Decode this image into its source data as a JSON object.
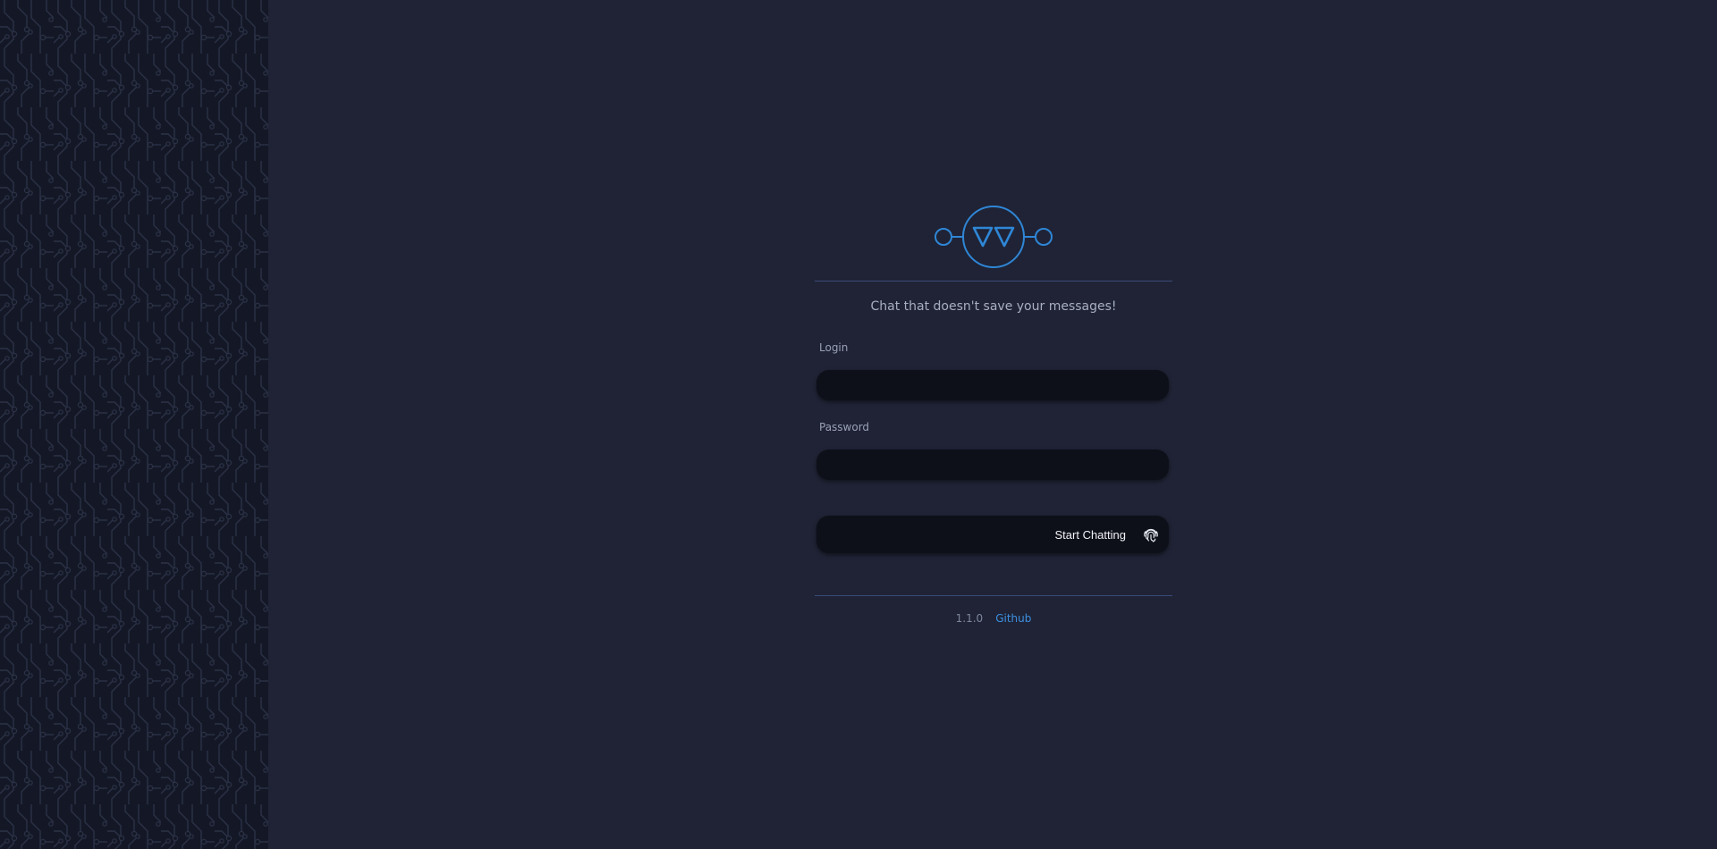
{
  "sidebar": {
    "decoration": "circuit-board-pattern"
  },
  "brand": {
    "logo_icon": "chat-logo-icon",
    "accent_color": "#2f86d6"
  },
  "tagline": "Chat that doesn't save your messages!",
  "form": {
    "login_label": "Login",
    "login_value": "",
    "password_label": "Password",
    "password_value": "",
    "submit_label": "Start Chatting",
    "submit_icon": "fingerprint-icon"
  },
  "footer": {
    "version": "1.1.0",
    "github_label": "Github",
    "link_color": "#3d8fe0"
  },
  "colors": {
    "background": "#1f2335",
    "sidebar": "#141826",
    "input_background": "#0e1019",
    "divider": "#3a4a7a"
  }
}
